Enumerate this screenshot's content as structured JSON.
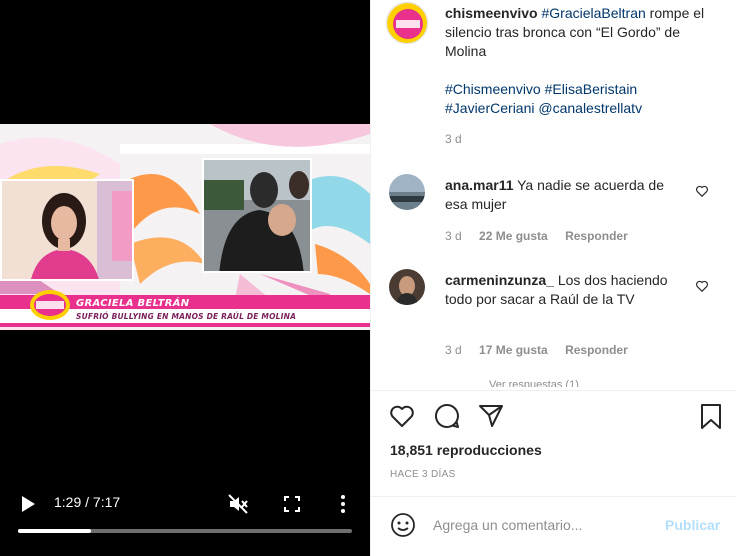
{
  "video": {
    "lower_third": {
      "name": "GRACIELA BELTRÁN",
      "subtitle": "SUFRIÓ BULLYING EN MANOS DE RAÚL DE MOLINA",
      "logo_icon": "chisme-en-vivo-logo"
    },
    "controls": {
      "time": "1:29 / 7:17",
      "progress": 0.22,
      "icons": [
        "play-icon",
        "mute-icon",
        "fullscreen-icon",
        "more-vertical-icon"
      ]
    }
  },
  "post": {
    "username": "chismeenvivo",
    "caption_tag": "#GracielaBeltran",
    "caption_text": " rompe el silencio tras bronca con “El Gordo” de Molina",
    "tags": [
      "#Chismeenvivo",
      "#ElisaBeristain",
      "#JavierCeriani",
      "@canalestrellatv"
    ],
    "time": "3 d"
  },
  "comments": [
    {
      "username": "ana.mar11",
      "text": " Ya nadie se acuerda de esa mujer",
      "time": "3 d",
      "likes": "22 Me gusta",
      "reply": "Responder"
    },
    {
      "username": "carmeninzunza_",
      "text": " Los dos haciendo todo por sacar a Raúl de la TV",
      "time": "3 d",
      "likes": "17 Me gusta",
      "reply": "Responder"
    }
  ],
  "more_replies": "Ver respuestas (1)",
  "actions": {
    "icons": [
      "heart-icon",
      "comment-icon",
      "share-icon",
      "bookmark-icon"
    ],
    "views": "18,851 reproducciones",
    "ago": "HACE 3 DÍAS"
  },
  "composer": {
    "placeholder": "Agrega un comentario...",
    "publish_label": "Publicar"
  },
  "colors": {
    "link": "#00376b",
    "muted": "#8e8e8e",
    "publish_disabled": "#b2dffc",
    "lower_third_pink": "#e8308c"
  }
}
